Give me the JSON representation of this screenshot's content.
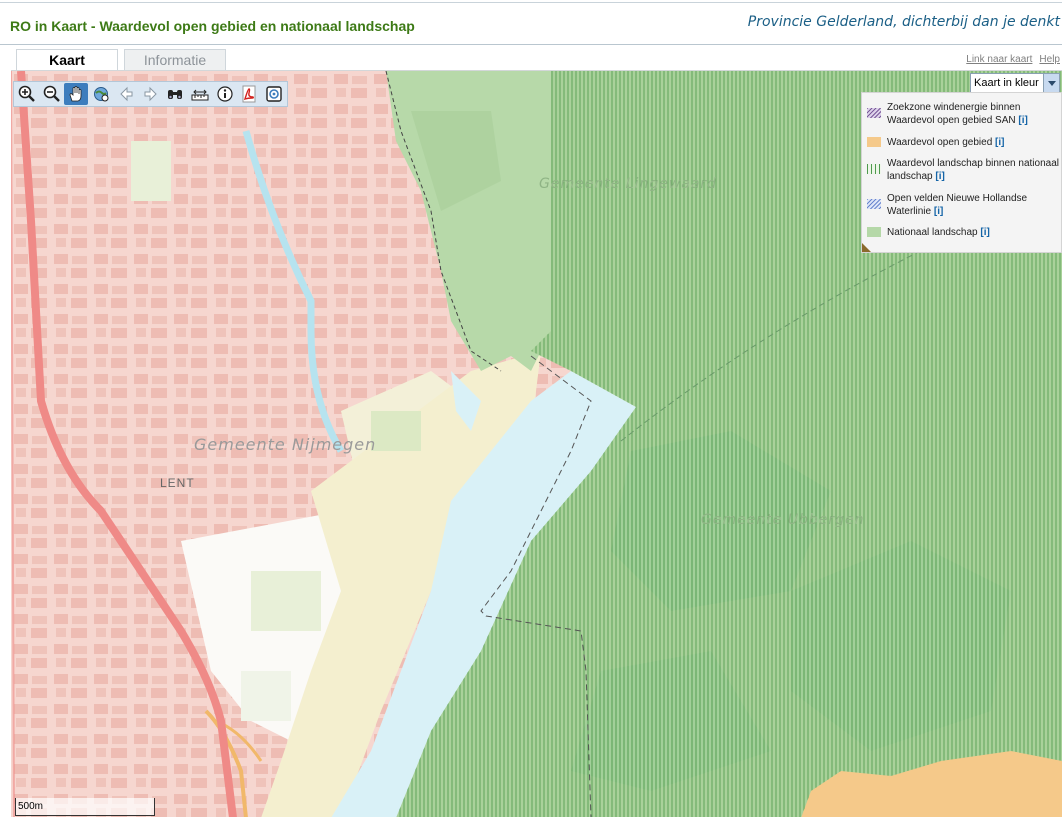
{
  "header": {
    "title": "RO in Kaart - Waardevol open gebied en nationaal landschap",
    "slogan": "Provincie Gelderland, dichterbij dan je denkt"
  },
  "tabs": [
    {
      "label": "Kaart",
      "active": true
    },
    {
      "label": "Informatie",
      "active": false
    }
  ],
  "links": {
    "map_link": "Link naar kaart",
    "help": "Help"
  },
  "toolbar": {
    "tools": [
      "zoom-in",
      "zoom-out",
      "pan",
      "zoom-extent",
      "previous-view",
      "next-view",
      "search",
      "measure",
      "info",
      "pdf",
      "overview"
    ]
  },
  "basemap": {
    "selected": "Kaart in kleur"
  },
  "legend": {
    "info_label": "[i]",
    "items": [
      {
        "label": "Zoekzone windenergie binnen Waardevol open gebied SAN",
        "color": "#8a6aa8",
        "pattern": "diagonal-lines"
      },
      {
        "label": "Waardevol open gebied",
        "color": "#f5c98a",
        "pattern": "solid"
      },
      {
        "label": "Waardevol landschap binnen nationaal landschap",
        "color": "#6fb06a",
        "pattern": "vertical-lines"
      },
      {
        "label": "Open velden Nieuwe Hollandse Waterlinie",
        "color": "#7a9ad8",
        "pattern": "diagonal-lines"
      },
      {
        "label": "Nationaal landschap",
        "color": "#b5d8a8",
        "pattern": "solid"
      }
    ]
  },
  "map": {
    "labels": {
      "nijmegen": "Gemeente Nijmegen",
      "lingewaard": "Gemeente Lingewaard",
      "ubbergen": "Gemeente Ubbergen",
      "lent": "LENT"
    },
    "scale": "500m"
  }
}
